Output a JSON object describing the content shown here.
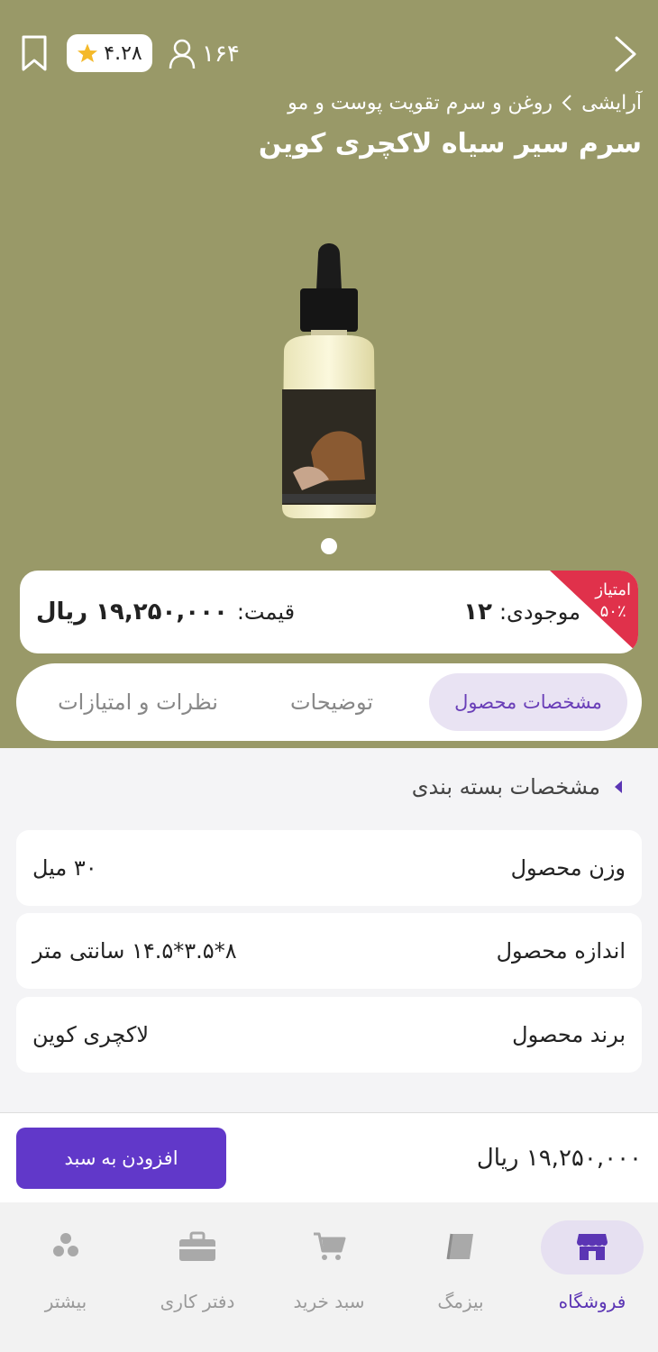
{
  "header": {
    "rating": "۴.۲۸",
    "views": "۱۶۴",
    "breadcrumb_parent": "آرایشی",
    "breadcrumb_current": "روغن و سرم تقویت پوست و مو",
    "title": "سرم سیر سیاه لاکچری کوین"
  },
  "gallery": {
    "total": 1,
    "current": 1
  },
  "price_card": {
    "badge_label": "امتیاز",
    "badge_value": "۵۰٪",
    "stock_label": "موجودی:",
    "stock_value": "۱۲",
    "price_label": "قیمت:",
    "price_value": "۱۹,۲۵۰,۰۰۰ ریال"
  },
  "tabs": [
    {
      "label": "مشخصات محصول",
      "active": true
    },
    {
      "label": "توضیحات",
      "active": false
    },
    {
      "label": "نظرات و امتیازات",
      "active": false
    }
  ],
  "specs": {
    "section_title": "مشخصات بسته بندی",
    "rows": [
      {
        "label": "وزن محصول",
        "value": "۳۰ میل"
      },
      {
        "label": "اندازه محصول",
        "value": "۸*۳.۵*۱۴.۵ سانتی متر"
      },
      {
        "label": "برند محصول",
        "value": "لاکچری کوین"
      }
    ]
  },
  "cart_bar": {
    "total": "۱۹,۲۵۰,۰۰۰ ریال",
    "add_button": "افزودن به سبد"
  },
  "bottom_nav": [
    {
      "label": "فروشگاه",
      "icon": "store-icon",
      "active": true
    },
    {
      "label": "بیزمگ",
      "icon": "book-icon",
      "active": false
    },
    {
      "label": "سبد خرید",
      "icon": "cart-icon",
      "active": false
    },
    {
      "label": "دفتر کاری",
      "icon": "briefcase-icon",
      "active": false
    },
    {
      "label": "بیشتر",
      "icon": "more-dots-icon",
      "active": false
    }
  ],
  "colors": {
    "hero_bg": "#999968",
    "accent": "#6138c9",
    "badge": "#e0314b"
  }
}
